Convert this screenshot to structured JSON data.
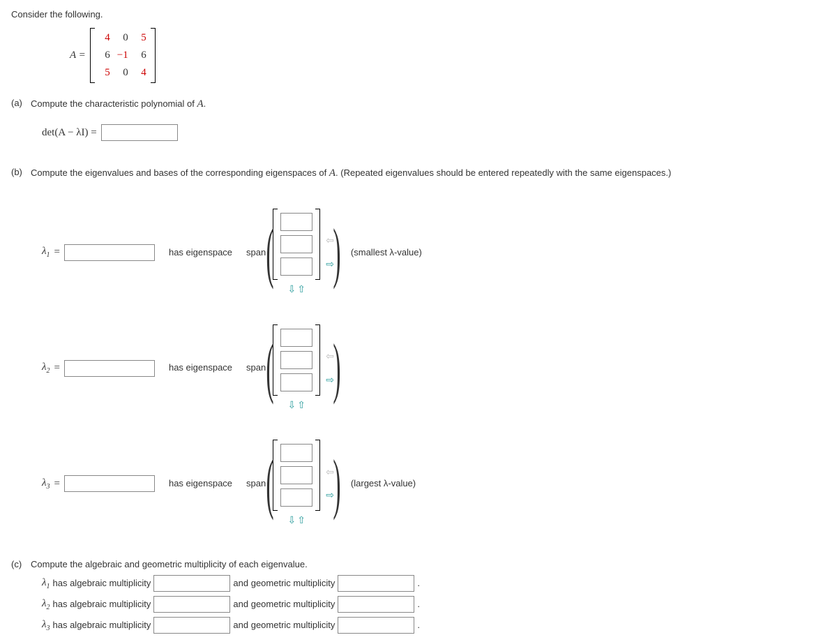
{
  "intro": "Consider the following.",
  "A_label": "A =",
  "matrix": [
    [
      "4",
      "0",
      "5"
    ],
    [
      "6",
      "−1",
      "6"
    ],
    [
      "5",
      "0",
      "4"
    ]
  ],
  "parts": {
    "a": {
      "label": "(a)",
      "text": "Compute the characteristic polynomial of ",
      "det": "det(A − λI) ="
    },
    "b": {
      "label": "(b)",
      "text": "Compute the eigenvalues and bases of the corresponding eigenspaces of ",
      "tail": ". (Repeated eigenvalues should be entered repeatedly with the same eigenspaces.)"
    },
    "c": {
      "label": "(c)",
      "text": "Compute the algebraic and geometric multiplicity of each eigenvalue."
    }
  },
  "eig": {
    "l1": "λ",
    "eq": "=",
    "mid": "has eigenspace",
    "span": "span",
    "smallest": "(smallest λ-value)",
    "largest": "(largest λ-value)"
  },
  "mult": {
    "alg": "has algebraic multiplicity",
    "geo": "and geometric multiplicity",
    "dot": "."
  },
  "A_short": "A",
  "A_dot": "."
}
